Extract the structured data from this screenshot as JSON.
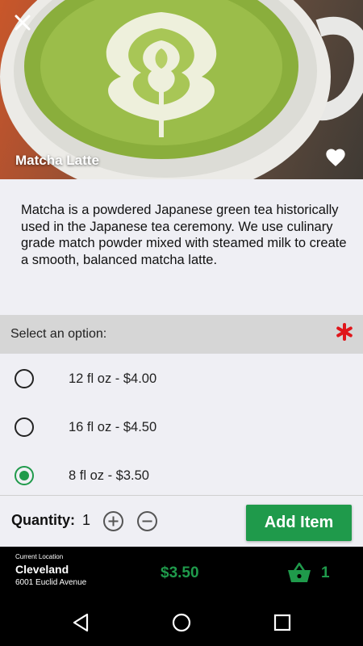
{
  "product": {
    "name": "Matcha Latte",
    "description": "Matcha is a powdered Japanese green tea historically used in the Japanese tea ceremony. We use culinary grade match powder mixed with steamed milk to create a smooth, balanced matcha latte."
  },
  "options": {
    "header": "Select an option:",
    "items": [
      {
        "label": "12 fl oz - $4.00",
        "selected": false
      },
      {
        "label": "16 fl oz - $4.50",
        "selected": false
      },
      {
        "label": "8 fl oz - $3.50",
        "selected": true
      }
    ]
  },
  "quantity": {
    "label": "Quantity:",
    "value": "1"
  },
  "actions": {
    "add_item": "Add Item"
  },
  "location": {
    "caption": "Current Location",
    "city": "Cleveland",
    "address": "6001 Euclid Avenue"
  },
  "cart": {
    "total": "$3.50",
    "count": "1"
  },
  "icons": {
    "close": "close-icon",
    "favorite": "heart-icon",
    "required": "asterisk-icon",
    "increment": "plus-circle-icon",
    "decrement": "minus-circle-icon",
    "cart": "basket-icon",
    "back": "back-triangle-icon",
    "home": "home-circle-icon",
    "recents": "recents-square-icon"
  },
  "colors": {
    "accent": "#1f9a4b",
    "required": "#e0161b",
    "footer": "#000000"
  }
}
